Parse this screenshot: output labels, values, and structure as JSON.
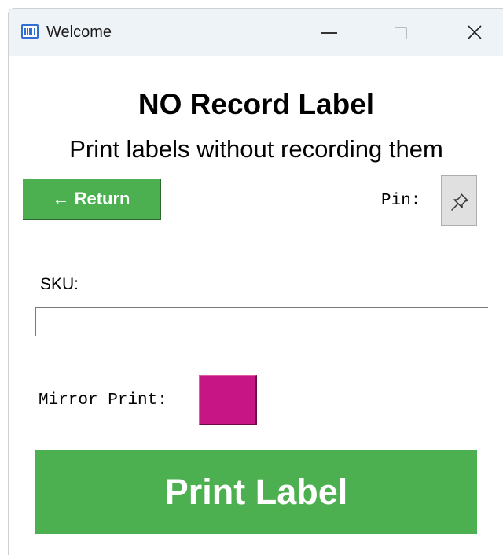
{
  "window": {
    "title": "Welcome",
    "controls": [
      "minimize",
      "maximize",
      "close"
    ]
  },
  "header": {
    "title": "NO Record Label",
    "subtitle": "Print labels without recording them"
  },
  "toolbar": {
    "return_label": "← Return",
    "pin_label": "Pin:",
    "pin_icon": "pushpin-icon"
  },
  "form": {
    "sku_label": "SKU:",
    "sku_value": "",
    "sku_placeholder": "",
    "mirror_label": "Mirror Print:",
    "mirror_color": "#c71585"
  },
  "actions": {
    "print_label": "Print Label"
  },
  "colors": {
    "accent_green": "#4caf50",
    "mirror_magenta": "#c71585",
    "titlebar_bg": "#eef3f8"
  }
}
